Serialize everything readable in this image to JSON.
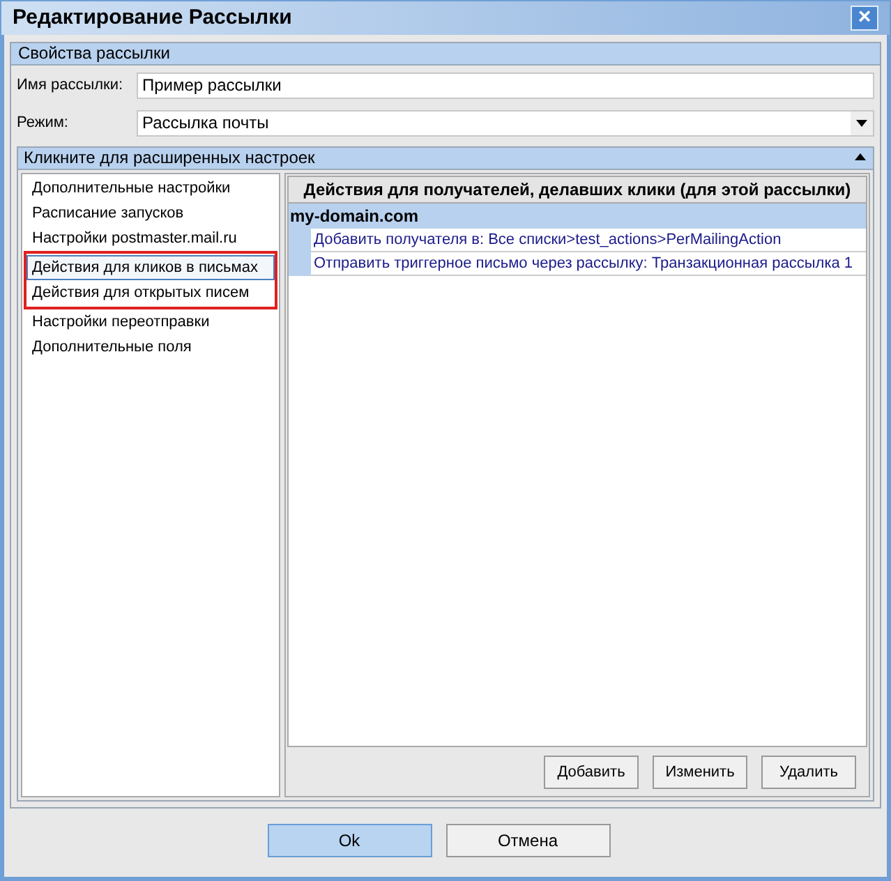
{
  "window": {
    "title": "Редактирование Рассылки",
    "close": "×"
  },
  "properties": {
    "title": "Свойства рассылки",
    "name_label": "Имя рассылки:",
    "name_value": "Пример рассылки",
    "mode_label": "Режим:",
    "mode_value": "Рассылка почты"
  },
  "advanced": {
    "title": "Кликните для расширенных настроек",
    "expanded": true,
    "items": [
      {
        "label": "Дополнительные настройки",
        "selected": false,
        "highlighted": false
      },
      {
        "label": "Расписание запусков",
        "selected": false,
        "highlighted": false
      },
      {
        "label": "Настройки postmaster.mail.ru",
        "selected": false,
        "highlighted": false
      },
      {
        "label": "Действия для кликов в письмах",
        "selected": true,
        "highlighted": true
      },
      {
        "label": "Действия для открытых писем",
        "selected": false,
        "highlighted": true
      },
      {
        "label": "Настройки переотправки",
        "selected": false,
        "highlighted": false
      },
      {
        "label": "Дополнительные поля",
        "selected": false,
        "highlighted": false
      }
    ],
    "table": {
      "header": "Действия для получателей, делавших клики (для этой рассылки)",
      "group": "my-domain.com",
      "rows": [
        "Добавить получателя в: Все списки>test_actions>PerMailingAction",
        "Отправить триггерное письмо через рассылку: Транзакционная рассылка 1"
      ]
    },
    "buttons": [
      "Добавить",
      "Изменить",
      "Удалить"
    ]
  },
  "footer": {
    "ok": "Ok",
    "cancel": "Отмена"
  }
}
